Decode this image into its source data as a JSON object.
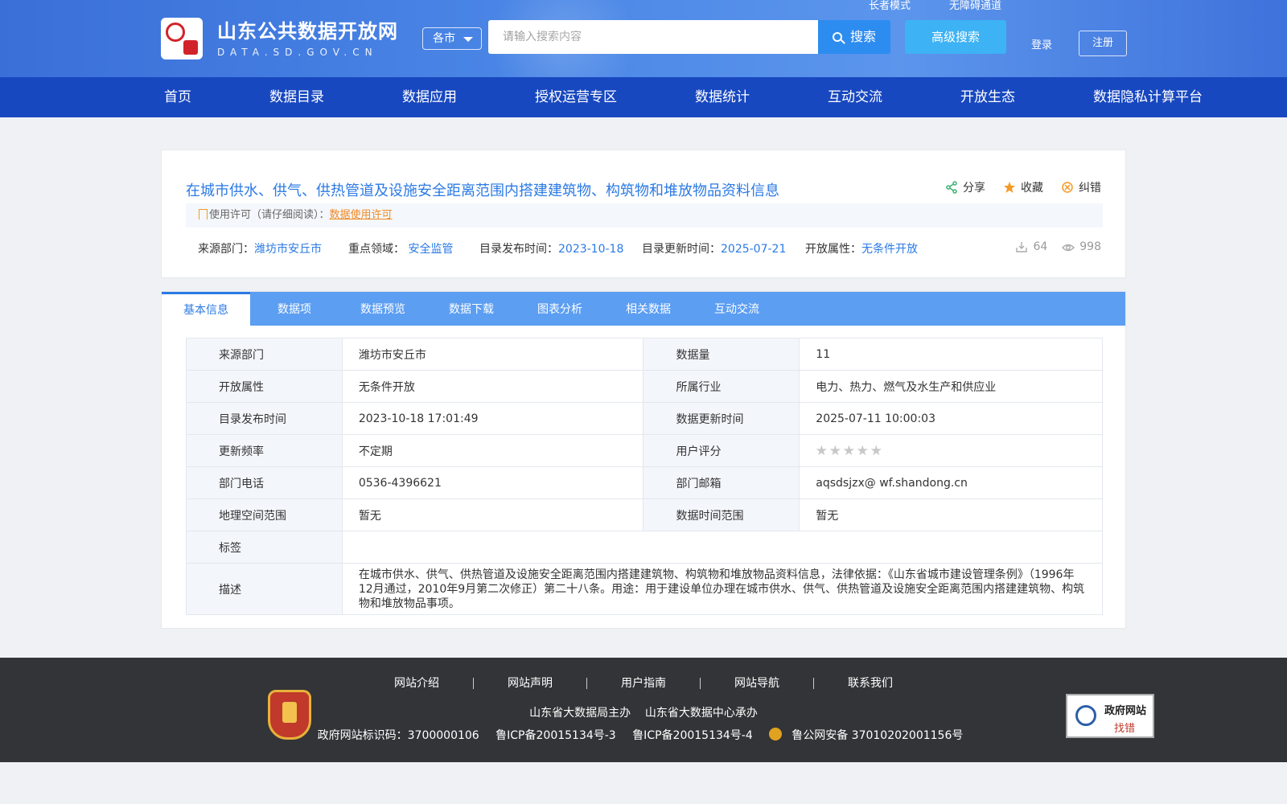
{
  "header": {
    "logo_cn": "山东公共数据开放网",
    "logo_en": "DATA.SD.GOV.CN",
    "city_select": "各市",
    "search_placeholder": "请输入搜索内容",
    "search_button": "搜索",
    "advanced_search": "高级搜索",
    "elder_mode": "长者模式",
    "accessibility": "无障碍通道",
    "login": "登录",
    "register": "注册"
  },
  "nav": [
    "首页",
    "数据目录",
    "数据应用",
    "授权运营专区",
    "数据统计",
    "互动交流",
    "开放生态",
    "数据隐私计算平台"
  ],
  "dataset": {
    "title": "在城市供水、供气、供热管道及设施安全距离范围内搭建建筑物、构筑物和堆放物品资料信息",
    "actions": {
      "share": "分享",
      "favorite": "收藏",
      "report": "纠错"
    },
    "license_label": "使用许可（请仔细阅读）：",
    "license_link": "数据使用许可",
    "meta": {
      "source_label": "来源部门：",
      "source_value": "潍坊市安丘市",
      "domain_label": "重点领域：",
      "domain_value": "安全监管",
      "publish_label": "目录发布时间：",
      "publish_value": "2023-10-18",
      "update_label": "目录更新时间：",
      "update_value": "2025-07-21",
      "open_label": "开放属性：",
      "open_value": "无条件开放"
    },
    "downloads": "64",
    "views": "998"
  },
  "tabs": [
    "基本信息",
    "数据项",
    "数据预览",
    "数据下载",
    "图表分析",
    "相关数据",
    "互动交流"
  ],
  "info": {
    "r1": {
      "l1": "来源部门",
      "v1": "潍坊市安丘市",
      "l2": "数据量",
      "v2": "11"
    },
    "r2": {
      "l1": "开放属性",
      "v1": "无条件开放",
      "l2": "所属行业",
      "v2": "电力、热力、燃气及水生产和供应业"
    },
    "r3": {
      "l1": "目录发布时间",
      "v1": "2023-10-18 17:01:49",
      "l2": "数据更新时间",
      "v2": "2025-07-11 10:00:03"
    },
    "r4": {
      "l1": "更新频率",
      "v1": "不定期",
      "l2": "用户评分"
    },
    "r5": {
      "l1": "部门电话",
      "v1": "0536-4396621",
      "l2": "部门邮箱",
      "v2": "aqsdsjzx@ wf.shandong.cn"
    },
    "r6": {
      "l1": "地理空间范围",
      "v1": "暂无",
      "l2": "数据时间范围",
      "v2": "暂无"
    },
    "r7": {
      "l1": "标签",
      "v1": ""
    },
    "r8": {
      "l1": "描述",
      "v1": "在城市供水、供气、供热管道及设施安全距离范围内搭建建筑物、构筑物和堆放物品资料信息，法律依据：《山东省城市建设管理条例》（1996年12月通过，2010年9月第二次修正）第二十八条。用途：用于建设单位办理在城市供水、供气、供热管道及设施安全距离范围内搭建建筑物、构筑物和堆放物品事项。"
    }
  },
  "rating": 0,
  "footer": {
    "links": [
      "网站介绍",
      "网站声明",
      "用户指南",
      "网站导航",
      "联系我们"
    ],
    "host": "山东省大数据局主办",
    "organizer": "山东省大数据中心承办",
    "site_id": "政府网站标识码：3700000106",
    "icp1": "鲁ICP备20015134号-3",
    "icp2": "鲁ICP备20015134号-4",
    "police": "鲁公网安备 37010202001156号",
    "badge_party": "党政机关",
    "badge_gov_1": "政府网站",
    "badge_gov_2": "找错"
  }
}
